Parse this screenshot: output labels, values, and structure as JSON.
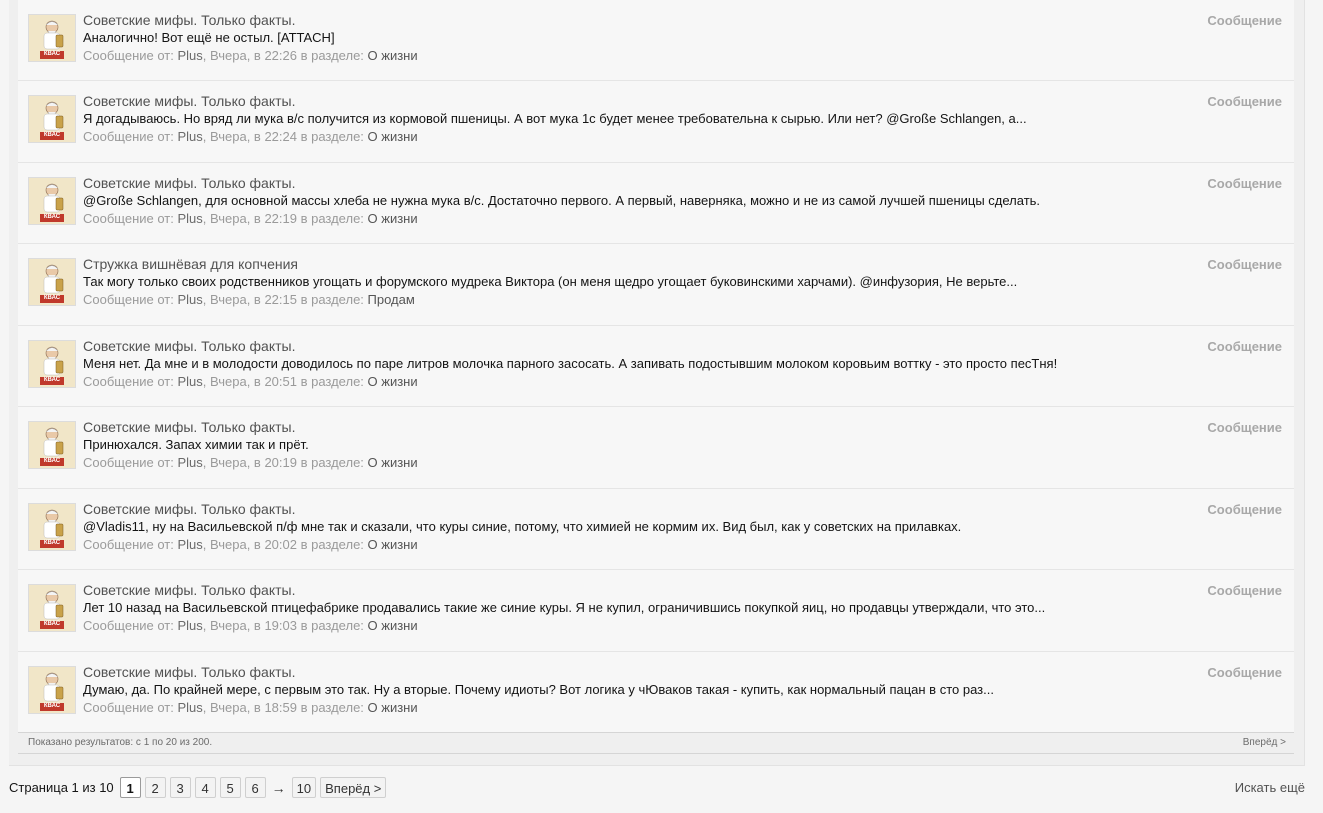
{
  "results": [
    {
      "title": "Советские мифы. Только факты.",
      "snippet": "Аналогично! Вот ещё не остыл. [ATTACH]",
      "meta_prefix": "Сообщение от: ",
      "author": "Plus",
      "time": ", Вчера, в 22:26 в разделе: ",
      "forum": "О жизни",
      "type": "Сообщение"
    },
    {
      "title": "Советские мифы. Только факты.",
      "snippet": "Я догадываюсь. Но вряд ли мука в/с получится из кормовой пшеницы. А вот мука 1с будет менее требовательна к сырью. Или нет? @Große Schlangen, а...",
      "meta_prefix": "Сообщение от: ",
      "author": "Plus",
      "time": ", Вчера, в 22:24 в разделе: ",
      "forum": "О жизни",
      "type": "Сообщение"
    },
    {
      "title": "Советские мифы. Только факты.",
      "snippet": "@Große Schlangen, для основной массы хлеба не нужна мука в/с. Достаточно первого. А первый, наверняка, можно и не из самой лучшей пшеницы сделать.",
      "meta_prefix": "Сообщение от: ",
      "author": "Plus",
      "time": ", Вчера, в 22:19 в разделе: ",
      "forum": "О жизни",
      "type": "Сообщение"
    },
    {
      "title": "Стружка вишнёвая для копчения",
      "snippet": "Так могу только своих родственников угощать и форумского мудрека Виктора (он меня щедро угощает буковинскими харчами). @инфузория, Не верьте...",
      "meta_prefix": "Сообщение от: ",
      "author": "Plus",
      "time": ", Вчера, в 22:15 в разделе: ",
      "forum": "Продам",
      "type": "Сообщение"
    },
    {
      "title": "Советские мифы. Только факты.",
      "snippet": "Меня нет. Да мне и в молодости доводилось по паре литров молочка парного засосать. А запивать подостывшим молоком коровьим воттку - это просто песТня!",
      "meta_prefix": "Сообщение от: ",
      "author": "Plus",
      "time": ", Вчера, в 20:51 в разделе: ",
      "forum": "О жизни",
      "type": "Сообщение"
    },
    {
      "title": "Советские мифы. Только факты.",
      "snippet": "Принюхался. Запах химии так и прёт.",
      "meta_prefix": "Сообщение от: ",
      "author": "Plus",
      "time": ", Вчера, в 20:19 в разделе: ",
      "forum": "О жизни",
      "type": "Сообщение"
    },
    {
      "title": "Советские мифы. Только факты.",
      "snippet": "@Vladis11, ну на Васильевской п/ф мне так и сказали, что куры синие, потому, что химией не кормим их. Вид был, как у советских на прилавках.",
      "meta_prefix": "Сообщение от: ",
      "author": "Plus",
      "time": ", Вчера, в 20:02 в разделе: ",
      "forum": "О жизни",
      "type": "Сообщение"
    },
    {
      "title": "Советские мифы. Только факты.",
      "snippet": "Лет 10 назад на Васильевской птицефабрике продавались такие же синие куры. Я не купил, ограничившись покупкой яиц, но продавцы утверждали, что это...",
      "meta_prefix": "Сообщение от: ",
      "author": "Plus",
      "time": ", Вчера, в 19:03 в разделе: ",
      "forum": "О жизни",
      "type": "Сообщение"
    },
    {
      "title": "Советские мифы. Только факты.",
      "snippet": "Думаю, да. По крайней мере, с первым это так. Ну а вторые. Почему идиоты? Вот логика у чЮваков такая - купить, как нормальный пацан в сто раз...",
      "meta_prefix": "Сообщение от: ",
      "author": "Plus",
      "time": ", Вчера, в 18:59 в разделе: ",
      "forum": "О жизни",
      "type": "Сообщение"
    }
  ],
  "footer": {
    "shown": "Показано результатов: с 1 по 20 из 200.",
    "next": "Вперёд >"
  },
  "pager": {
    "label": "Страница 1 из 10",
    "pages": [
      "1",
      "2",
      "3",
      "4",
      "5",
      "6"
    ],
    "arrow": "→",
    "last": "10",
    "next": "Вперёд >"
  },
  "search_more": "Искать ещё",
  "avatar_caption": "КВАС"
}
